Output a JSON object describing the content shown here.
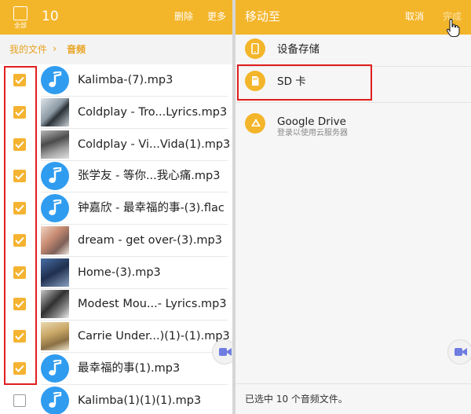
{
  "left": {
    "select_all_label": "全部",
    "selected_count": "10",
    "delete_label": "删除",
    "more_label": "更多",
    "breadcrumb": {
      "root": "我的文件",
      "separator": "›",
      "current": "音频"
    },
    "files": [
      {
        "name": "Kalimba-(7).mp3",
        "checked": true,
        "thumb": "music-note-icon"
      },
      {
        "name": "Coldplay - Tro...Lyrics.mp3",
        "checked": true,
        "thumb": "album-art"
      },
      {
        "name": "Coldplay - Vi...Vida(1).mp3",
        "checked": true,
        "thumb": "album-art"
      },
      {
        "name": "张学友 - 等你...我心痛.mp3",
        "checked": true,
        "thumb": "music-note-icon"
      },
      {
        "name": "钟嘉欣 - 最幸福的事-(3).flac",
        "checked": true,
        "thumb": "music-note-icon"
      },
      {
        "name": "dream - get over-(3).mp3",
        "checked": true,
        "thumb": "album-art"
      },
      {
        "name": "Home-(3).mp3",
        "checked": true,
        "thumb": "album-art"
      },
      {
        "name": "Modest Mou...- Lyrics.mp3",
        "checked": true,
        "thumb": "album-art"
      },
      {
        "name": "Carrie Under...)(1)-(1).mp3",
        "checked": true,
        "thumb": "album-art"
      },
      {
        "name": "最幸福的事(1).mp3",
        "checked": true,
        "thumb": "music-note-icon"
      },
      {
        "name": "Kalimba(1)(1)(1).mp3",
        "checked": false,
        "thumb": "music-note-icon"
      }
    ]
  },
  "right": {
    "title": "移动至",
    "cancel_label": "取消",
    "done_label": "完成",
    "options": [
      {
        "label": "设备存储",
        "icon": "phone-icon"
      },
      {
        "label": "SD 卡",
        "icon": "sd-card-icon"
      },
      {
        "label": "Google Drive",
        "sublabel": "登录以使用云服务器",
        "icon": "cloud-drive-icon"
      }
    ],
    "footer_status": "已选中 10 个音频文件。"
  },
  "colors": {
    "header": "#f3b52a",
    "checkbox": "#f4b331",
    "music_icon": "#2f9cf0",
    "highlight_box": "#e01e1e",
    "breadcrumb": "#e8a21f"
  }
}
